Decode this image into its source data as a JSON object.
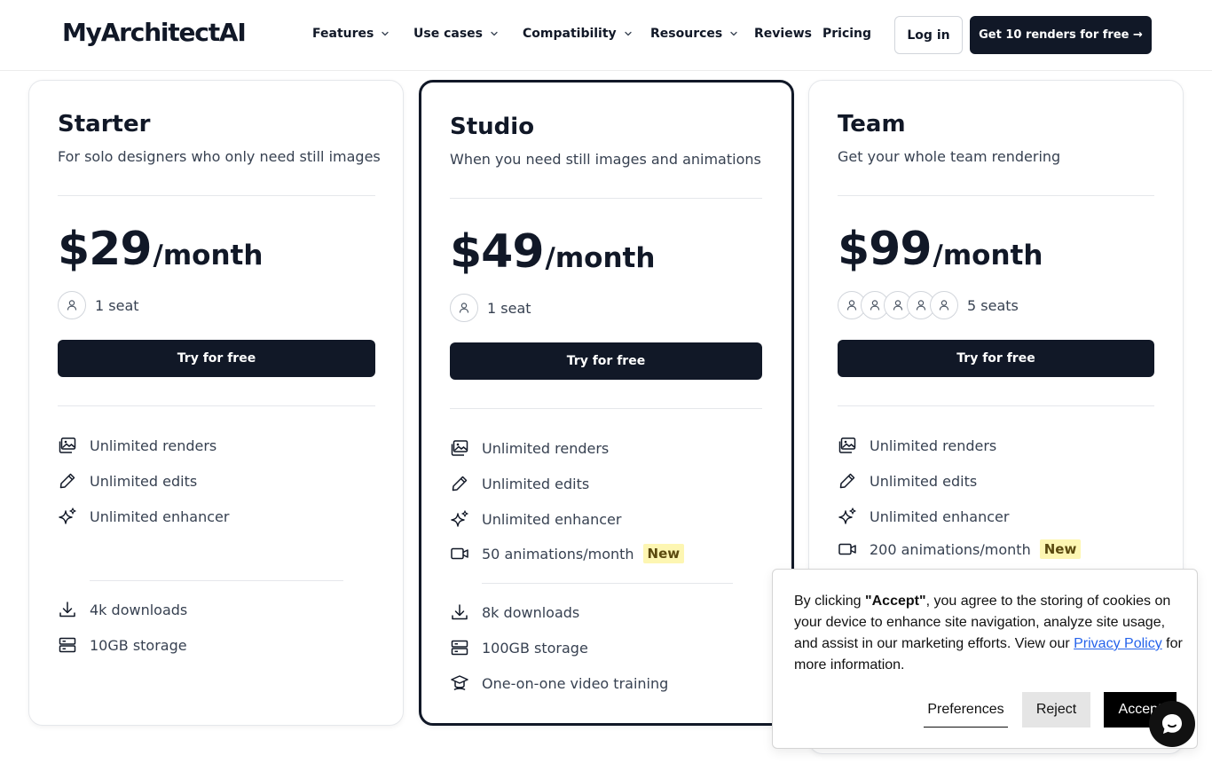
{
  "header": {
    "logo": "MyArchitectAI",
    "nav": {
      "features": "Features",
      "use_cases": "Use cases",
      "compatibility": "Compatibility",
      "resources": "Resources",
      "reviews": "Reviews",
      "pricing": "Pricing"
    },
    "login": "Log in",
    "cta": "Get 10 renders for free →"
  },
  "plans": {
    "starter": {
      "name": "Starter",
      "description": "For solo designers who only need still images",
      "price": "$29",
      "period": "/month",
      "seats": "1 seat",
      "button": "Try for free",
      "features": [
        "Unlimited renders",
        "Unlimited edits",
        "Unlimited enhancer"
      ],
      "extras": [
        "4k downloads",
        "10GB storage"
      ]
    },
    "studio": {
      "name": "Studio",
      "description": "When you need still images and animations",
      "price": "$49",
      "period": "/month",
      "seats": "1 seat",
      "button": "Try for free",
      "features": [
        "Unlimited renders",
        "Unlimited edits",
        "Unlimited enhancer",
        "50 animations/month"
      ],
      "new_badge": "New",
      "extras": [
        "8k downloads",
        "100GB storage",
        "One-on-one video training"
      ]
    },
    "team": {
      "name": "Team",
      "description": "Get your whole team rendering",
      "price": "$99",
      "period": "/month",
      "seats": "5 seats",
      "button": "Try for free",
      "features": [
        "Unlimited renders",
        "Unlimited edits",
        "Unlimited enhancer",
        "200 animations/month"
      ],
      "new_badge": "New"
    }
  },
  "cookie": {
    "text_1": "By clicking ",
    "accept_quote": "\"Accept\"",
    "text_2": ", you agree to the storing of cookies on your device to enhance site navigation, analyze site usage, and assist in our marketing efforts. View our ",
    "privacy_link": "Privacy Policy",
    "text_3": " for more information.",
    "preferences": "Preferences",
    "reject": "Reject",
    "accept": "Accept"
  },
  "icons": {
    "chevron": "chevron-down-icon",
    "seat": "user-icon",
    "renders": "image-gallery-icon",
    "edits": "pencil-icon",
    "enhancer": "sparkle-icon",
    "animations": "video-camera-icon",
    "downloads": "download-icon",
    "storage": "server-icon",
    "training": "graduation-cap-icon",
    "chat": "chat-bubble-icon"
  },
  "colors": {
    "primary": "#111827",
    "badge_bg": "#fdf6b2",
    "link": "#2563eb"
  }
}
